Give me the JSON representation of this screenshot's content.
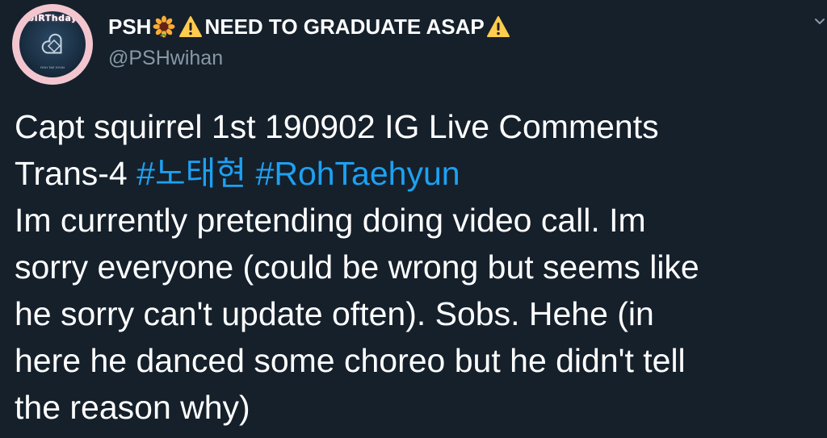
{
  "user": {
    "display_name": "PSH",
    "display_name_suffix": "NEED TO GRADUATE ASAP",
    "handle": "@PSHwihan",
    "avatar_label": "bIRThday",
    "avatar_caption": "ROH TAE HYUN",
    "icons": [
      "sunflower-emoji",
      "warning-emoji",
      "warning-emoji"
    ]
  },
  "tweet": {
    "line1": "Capt squirrel 1st 190902 IG Live Comments",
    "line2_prefix": "Trans-4",
    "hashtag_1": "#노태현",
    "hashtag_2": "#RohTaehyun",
    "line3": "Im currently pretending doing video call. Im",
    "line4": "sorry everyone (could be wrong but seems like",
    "line5": "he sorry can't update often). Sobs. Hehe (in",
    "line6": "here he danced some choreo but he didn't tell",
    "line7": "the reason why)"
  },
  "colors": {
    "background": "#15202b",
    "text": "#ffffff",
    "secondary": "#8899a6",
    "link": "#1da1f2",
    "warning": "#ffcc4d"
  }
}
